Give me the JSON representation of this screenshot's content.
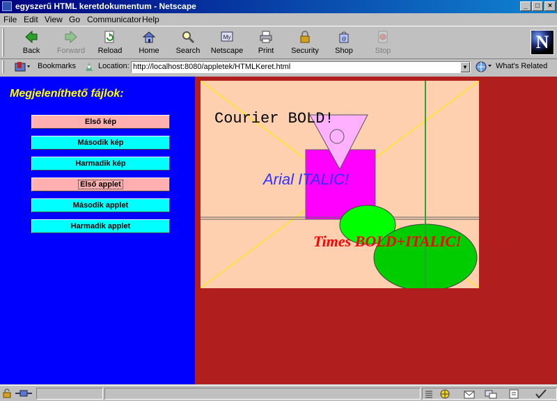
{
  "window": {
    "title": "egyszerű HTML keretdokumentum - Netscape"
  },
  "menu": [
    "File",
    "Edit",
    "View",
    "Go",
    "Communicator",
    "Help"
  ],
  "toolbar": {
    "buttons": [
      {
        "label": "Back",
        "icon": "back-arrow-icon"
      },
      {
        "label": "Forward",
        "icon": "forward-arrow-icon"
      },
      {
        "label": "Reload",
        "icon": "reload-icon"
      },
      {
        "label": "Home",
        "icon": "home-icon"
      },
      {
        "label": "Search",
        "icon": "search-icon"
      },
      {
        "label": "Netscape",
        "icon": "my-netscape-icon"
      },
      {
        "label": "Print",
        "icon": "printer-icon"
      },
      {
        "label": "Security",
        "icon": "padlock-icon"
      },
      {
        "label": "Shop",
        "icon": "shop-icon"
      },
      {
        "label": "Stop",
        "icon": "stop-icon"
      }
    ]
  },
  "location": {
    "bookmarks_label": "Bookmarks",
    "location_label": "Location:",
    "url": "http://localhost:8080/appletek/HTMLKeret.html",
    "whats_related_label": "What's Related"
  },
  "left_frame": {
    "title": "Megjeleníthető fájlok:",
    "buttons": [
      "Első kép",
      "Második kép",
      "Harmadik kép",
      "Első applet",
      "Második applet",
      "Harmadik applet"
    ]
  },
  "applet": {
    "text_courier": "Courier BOLD!",
    "text_arial": "Arial ITALIC!",
    "text_times": "Times BOLD+ITALIC!"
  },
  "colors": {
    "left_bg": "#0000ff",
    "right_bg": "#b01e1e",
    "applet_bg": "#ffd0b0",
    "title_yellow": "#ffff00",
    "button_cyan": "#00ffff",
    "button_pink": "#ffafaf"
  }
}
